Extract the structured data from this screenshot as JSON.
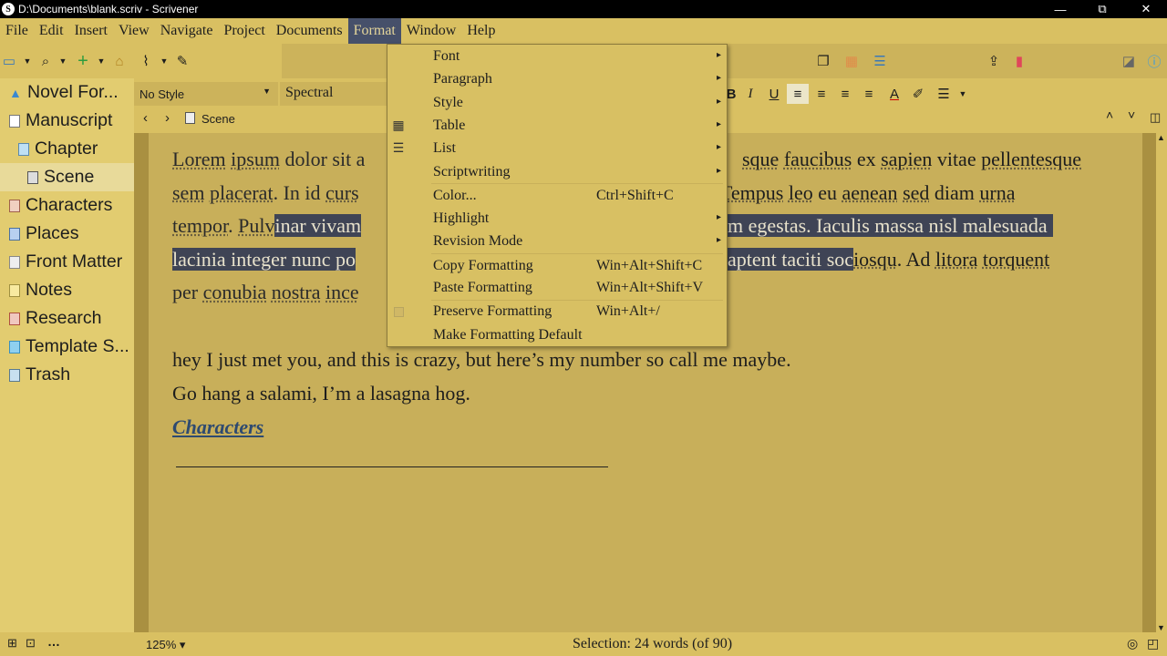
{
  "window": {
    "title": "D:\\Documents\\blank.scriv - Scrivener",
    "app_icon_glyph": "S",
    "controls": {
      "minimize": "—",
      "maximize": "⧉",
      "close": "✕"
    }
  },
  "menubar": [
    "File",
    "Edit",
    "Insert",
    "View",
    "Navigate",
    "Project",
    "Documents",
    "Format",
    "Window",
    "Help"
  ],
  "binder": [
    {
      "label": "Novel For...",
      "icon": "warning-icon"
    },
    {
      "label": "Manuscript",
      "icon": "document-icon"
    },
    {
      "label": "Chapter",
      "icon": "folder-icon"
    },
    {
      "label": "Scene",
      "icon": "scene-icon"
    },
    {
      "label": "Characters",
      "icon": "characters-icon"
    },
    {
      "label": "Places",
      "icon": "places-icon"
    },
    {
      "label": "Front Matter",
      "icon": "front-matter-icon"
    },
    {
      "label": "Notes",
      "icon": "notes-icon"
    },
    {
      "label": "Research",
      "icon": "research-icon"
    },
    {
      "label": "Template S...",
      "icon": "template-icon"
    },
    {
      "label": "Trash",
      "icon": "trash-icon"
    }
  ],
  "formatbar": {
    "style_value": "No Style",
    "font_value": "Spectral"
  },
  "header": {
    "doc_title": "Scene"
  },
  "editor": {
    "lines": [
      [
        "Lorem",
        " ",
        "ipsum",
        " dolor sit a"
      ],
      [
        "sem",
        " ",
        "placerat",
        ". In id ",
        "curs"
      ],
      [
        "tempor",
        ". ",
        "Pulv"
      ]
    ],
    "line1_right": [
      "sque",
      " ",
      "faucibus",
      " ex ",
      "sapien",
      " vitae ",
      "pellentesque"
    ],
    "line2_right": [
      "Tempus",
      " ",
      "leo",
      " eu ",
      "aenean",
      " ",
      "sed",
      " diam ",
      "urna"
    ],
    "line3_sel_left": "inar vivam",
    "line3_sel_right": "m egestas. Iaculis massa nisl malesuada",
    "line4_sel_left": "lacinia integer nunc po",
    "line4_sel_right": "aptent taciti soc",
    "line4_after": [
      "iosqu",
      ". Ad ",
      "litora",
      " ",
      "torquent"
    ],
    "line5": [
      "per ",
      "conubia",
      " ",
      "nostra",
      " ",
      "ince"
    ],
    "para2": "hey I just met you, and this is crazy, but here’s my number so call me maybe.",
    "para3": "Go hang a salami, I’m a lasagna hog.",
    "link": "Characters"
  },
  "footer": {
    "zoom": "125%",
    "status": "Selection: 24 words (of 90)"
  },
  "format_menu": [
    {
      "label": "Font",
      "submenu": true,
      "icon": ""
    },
    {
      "label": "Paragraph",
      "submenu": true,
      "icon": ""
    },
    {
      "label": "Style",
      "submenu": true,
      "icon": ""
    },
    {
      "label": "Table",
      "submenu": true,
      "icon": "table-icon"
    },
    {
      "label": "List",
      "submenu": true,
      "icon": "list-icon"
    },
    {
      "label": "Scriptwriting",
      "submenu": true,
      "icon": ""
    },
    {
      "label": "Color...",
      "shortcut": "Ctrl+Shift+C"
    },
    {
      "label": "Highlight",
      "submenu": true
    },
    {
      "label": "Revision Mode",
      "submenu": true
    },
    {
      "label": "Copy Formatting",
      "shortcut": "Win+Alt+Shift+C"
    },
    {
      "label": "Paste Formatting",
      "shortcut": "Win+Alt+Shift+V"
    },
    {
      "label": "Preserve Formatting",
      "shortcut": "Win+Alt+/",
      "icon": "checkbox-icon"
    },
    {
      "label": "Make Formatting Default"
    }
  ],
  "colors": {
    "background": "#d9c062",
    "editor": "#c8af5a",
    "menu_highlight": "#46506a",
    "selection": "#3f4455",
    "link": "#2e4a70"
  }
}
